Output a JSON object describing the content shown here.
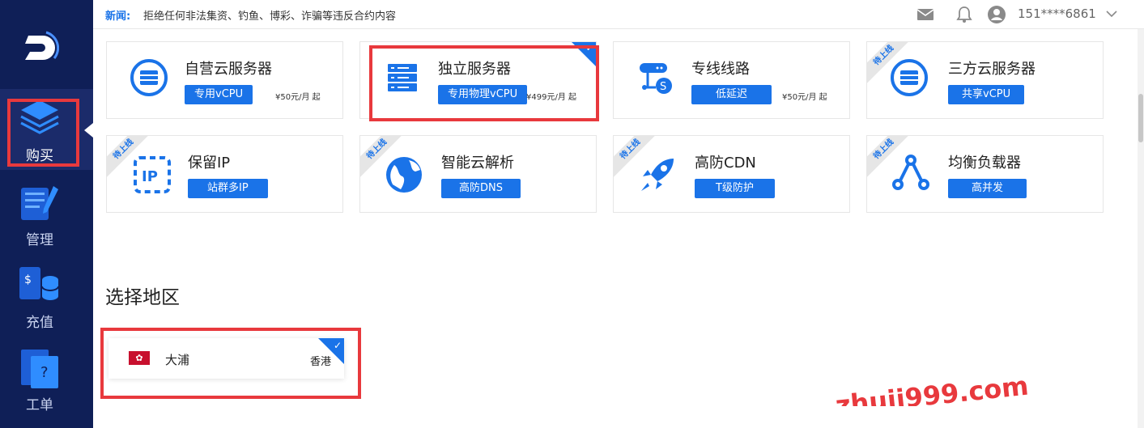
{
  "news": {
    "label": "新闻:",
    "text": "拒绝任何非法集资、钓鱼、博彩、诈骗等违反合约内容"
  },
  "user": {
    "phone": "151****6861"
  },
  "sidebar": {
    "items": [
      {
        "label": "购买",
        "icon": "layers-icon",
        "active": true
      },
      {
        "label": "管理",
        "icon": "document-pen-icon",
        "active": false
      },
      {
        "label": "充值",
        "icon": "coins-icon",
        "active": false
      },
      {
        "label": "工单",
        "icon": "ticket-question-icon",
        "active": false
      }
    ]
  },
  "products": [
    {
      "title": "自营云服务器",
      "tag": "专用vCPU",
      "price": "¥50元/月 起",
      "icon": "server-circle-icon",
      "status": "",
      "selected": false
    },
    {
      "title": "独立服务器",
      "tag": "专用物理vCPU",
      "price": "¥499元/月 起",
      "icon": "server-rack-icon",
      "status": "",
      "selected": true
    },
    {
      "title": "专线线路",
      "tag": "低延迟",
      "price": "¥50元/月 起",
      "icon": "network-line-icon",
      "status": "",
      "selected": false
    },
    {
      "title": "三方云服务器",
      "tag": "共享vCPU",
      "price": "",
      "icon": "server-circle-icon",
      "status": "待上线",
      "selected": false
    },
    {
      "title": "保留IP",
      "tag": "站群多IP",
      "price": "",
      "icon": "ip-icon",
      "status": "待上线",
      "selected": false
    },
    {
      "title": "智能云解析",
      "tag": "高防DNS",
      "price": "",
      "icon": "globe-icon",
      "status": "待上线",
      "selected": false
    },
    {
      "title": "高防CDN",
      "tag": "T级防护",
      "price": "",
      "icon": "rocket-icon",
      "status": "待上线",
      "selected": false
    },
    {
      "title": "均衡负载器",
      "tag": "高并发",
      "price": "",
      "icon": "load-balancer-icon",
      "status": "待上线",
      "selected": false
    }
  ],
  "region_section": {
    "title": "选择地区"
  },
  "region": {
    "name": "大浦",
    "area": "香港",
    "selected": true
  },
  "watermark": "zhuji999.com",
  "colors": {
    "sidebar": "#0f1f57",
    "accent": "#1a73e8",
    "highlight": "#e8393d"
  }
}
